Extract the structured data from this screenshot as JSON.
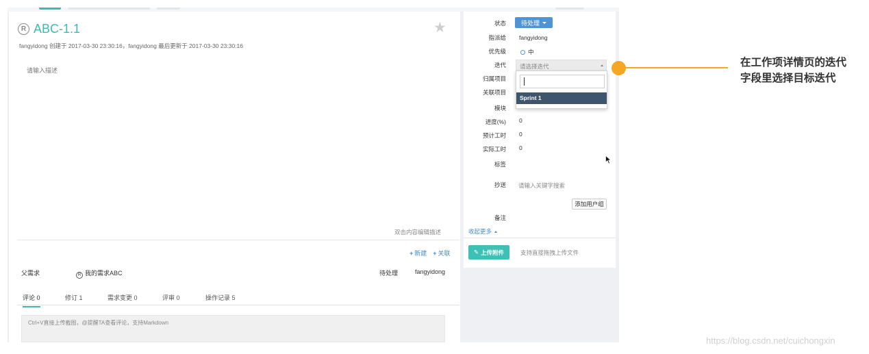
{
  "issue": {
    "title": "ABC-1.1",
    "meta": "fangyidong 创建于 2017-03-30 23:30:16，fangyidong 最后更新于 2017-03-30 23:30:16",
    "description_placeholder": "请输入描述",
    "edit_hint": "双击内容编辑描述"
  },
  "actions": {
    "new_label": "新建",
    "link_label": "关联"
  },
  "parent": {
    "label": "父需求",
    "name": "我的需求ABC",
    "reg_glyph": "R",
    "status": "待处理",
    "assignee": "fangyidong"
  },
  "tabs": [
    {
      "label": "评论 0"
    },
    {
      "label": "修订 1"
    },
    {
      "label": "需求变更 0"
    },
    {
      "label": "评审 0"
    },
    {
      "label": "操作记录 5"
    }
  ],
  "comment": {
    "placeholder": "Ctrl+V直接上传截图，@提醒TA查看评论，支持Markdown"
  },
  "sidebar": {
    "status_label": "状态",
    "status_value": "待处理",
    "assignee_label": "指派给",
    "assignee_value": "fangyidong",
    "priority_label": "优先级",
    "priority_value": "中",
    "iteration_label": "迭代",
    "iteration_placeholder": "请选择迭代",
    "project_label": "归属项目",
    "related_label": "关联项目",
    "module_label": "模块",
    "progress_label": "进度(%)",
    "progress_value": "0",
    "estimate_label": "预计工时",
    "estimate_value": "0",
    "actual_label": "实际工时",
    "actual_value": "0",
    "tags_label": "标签",
    "cc_label": "抄送",
    "cc_placeholder": "请输入关键字搜索",
    "add_group_label": "添加用户组",
    "remark_label": "备注",
    "collapse_label": "收起更多",
    "upload_label": "上传附件",
    "upload_hint": "支持直接拖拽上传文件"
  },
  "dropdown": {
    "options": [
      "Sprint 1"
    ]
  },
  "callout": {
    "line1": "在工作项详情页的迭代",
    "line2": "字段里选择目标迭代"
  },
  "watermark": "https://blog.csdn.net/cuichongxin",
  "colors": {
    "accent": "#3fb8b0",
    "primary": "#4f94d4",
    "callout": "#f5a623",
    "selected": "#3e556e"
  }
}
